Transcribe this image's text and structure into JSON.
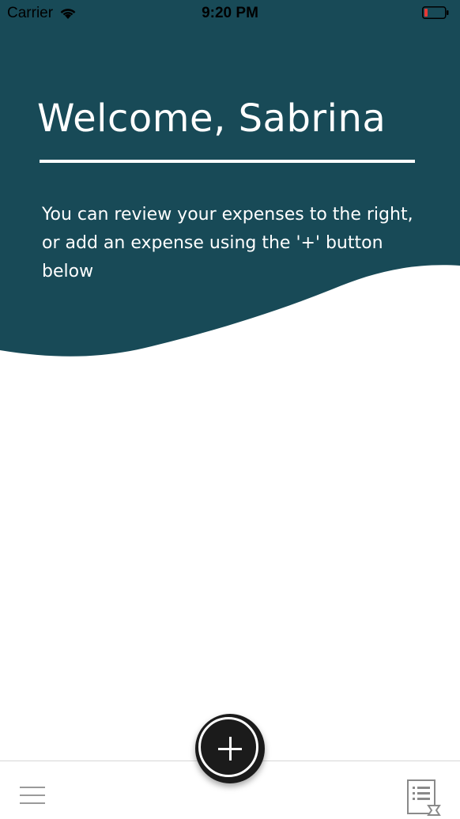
{
  "status_bar": {
    "carrier": "Carrier",
    "time": "9:20 PM",
    "battery_color": "#e53935"
  },
  "hero": {
    "background_color": "#184a57",
    "title": "Welcome, Sabrina",
    "message": "You can review your expenses to the right, or add an expense using the '+' button below"
  },
  "bottom_bar": {
    "menu_icon": "hamburger-menu-icon",
    "add_icon": "plus-icon",
    "expenses_icon": "expense-report-icon"
  }
}
